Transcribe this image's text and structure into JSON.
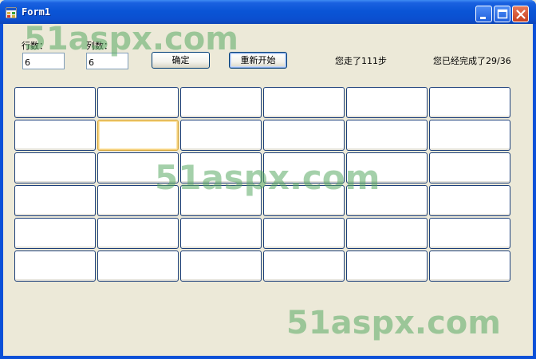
{
  "window": {
    "title": "Form1"
  },
  "form": {
    "rows_label": "行数：",
    "cols_label": "列数：",
    "rows_value": "6",
    "cols_value": "6",
    "confirm_button": "确定",
    "restart_button": "重新开始",
    "steps_text": "您走了111步",
    "progress_text": "您已经完成了29/36"
  },
  "grid": {
    "rows": 6,
    "cols": 6,
    "highlighted_cell": "row 2, column 2"
  },
  "watermark": "51aspx.com",
  "colors": {
    "title_bar": "#0a55d6",
    "close_button": "#c8401f",
    "client_bg": "#ece9d8",
    "cell_border": "#1c3f7a",
    "hover_border": "#d4a53a"
  }
}
